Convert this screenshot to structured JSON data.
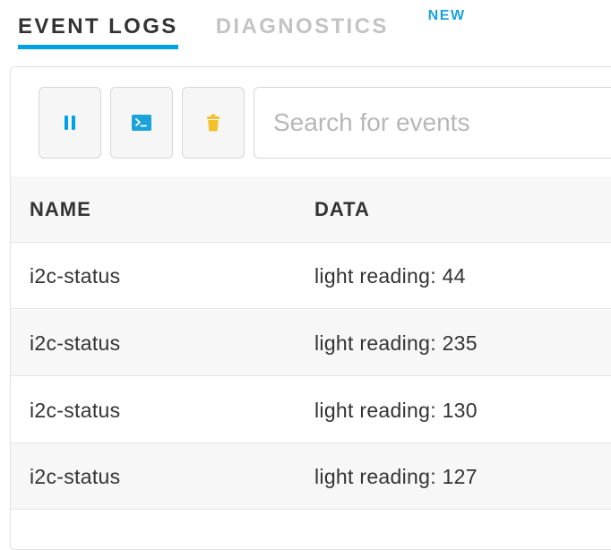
{
  "tabs": [
    {
      "label": "EVENT LOGS",
      "active": true
    },
    {
      "label": "DIAGNOSTICS",
      "active": false,
      "badge": "NEW"
    }
  ],
  "toolbar": {
    "pause_icon": "pause-icon",
    "console_icon": "terminal-icon",
    "clear_icon": "trash-icon",
    "search_placeholder": "Search for events",
    "search_value": ""
  },
  "table": {
    "columns": [
      "NAME",
      "DATA"
    ],
    "rows": [
      {
        "name": "i2c-status",
        "data": "light reading: 44"
      },
      {
        "name": "i2c-status",
        "data": "light reading: 235"
      },
      {
        "name": "i2c-status",
        "data": "light reading: 130"
      },
      {
        "name": "i2c-status",
        "data": "light reading: 127"
      }
    ]
  },
  "colors": {
    "accent": "#00a2e5",
    "badge": "#1ba2d9",
    "clear_icon": "#f2c12e",
    "inactive_tab": "#c3c3c3"
  }
}
